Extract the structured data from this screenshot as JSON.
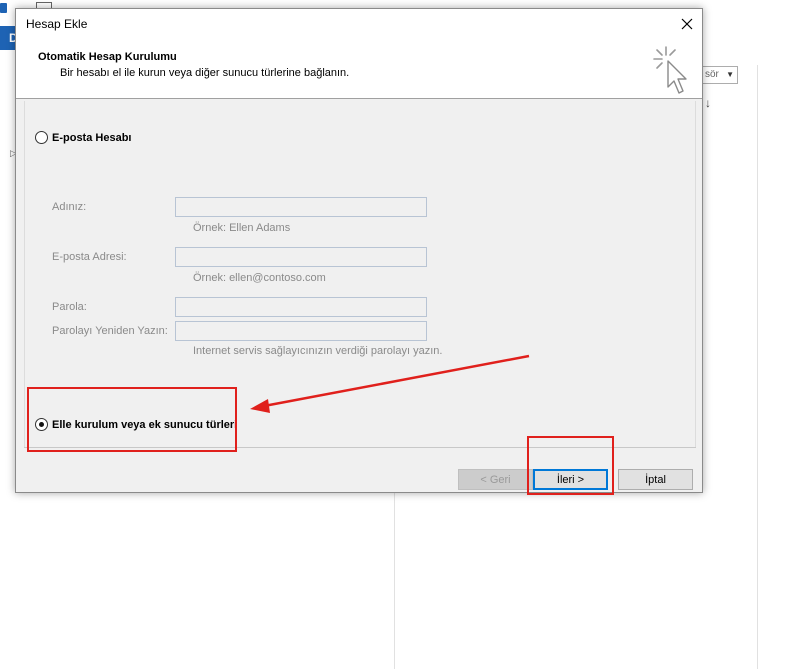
{
  "background": {
    "ribbon_letter": "D",
    "dropdown_value": "sör",
    "sort_arrow": "↓",
    "left_glyph": "▷"
  },
  "dialog": {
    "title": "Hesap Ekle",
    "header": {
      "title": "Otomatik Hesap Kurulumu",
      "subtitle": "Bir hesabı el ile kurun veya diğer sunucu türlerine bağlanın."
    },
    "email_option": {
      "label": "E-posta Hesabı",
      "checked": false
    },
    "fields": {
      "name": {
        "label": "Adınız:",
        "value": "",
        "hint": "Örnek: Ellen Adams"
      },
      "email": {
        "label": "E-posta Adresi:",
        "value": "",
        "hint": "Örnek: ellen@contoso.com"
      },
      "password": {
        "label": "Parola:",
        "value": ""
      },
      "password_confirm": {
        "label": "Parolayı Yeniden Yazın:",
        "value": "",
        "hint": "Internet servis sağlayıcınızın verdiği parolayı yazın."
      }
    },
    "manual_option": {
      "label": "Elle kurulum veya ek sunucu türleri",
      "checked": true
    },
    "buttons": {
      "back": "< Geri",
      "next": "İleri >",
      "cancel": "İptal"
    }
  },
  "colors": {
    "annotation_red": "#e0201c",
    "focus_blue": "#0078d7",
    "ribbon_blue": "#1e63b4"
  }
}
